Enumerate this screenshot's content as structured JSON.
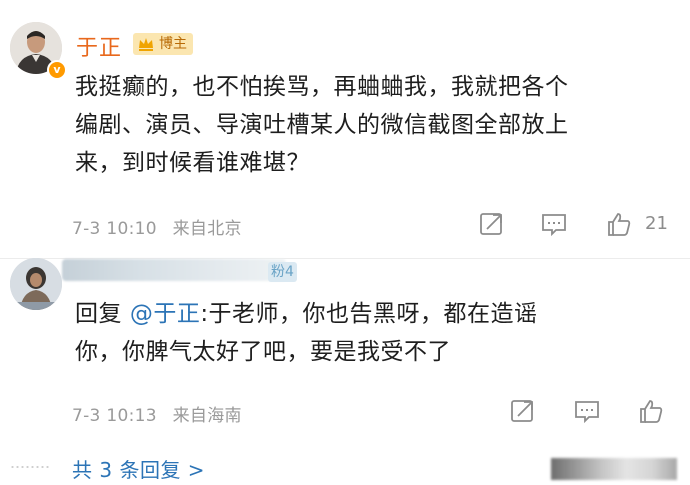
{
  "comments": [
    {
      "username": "于正",
      "badge": "博主",
      "verified_mark": "v",
      "text_lines": [
        "我挺癫的，也不怕挨骂，再蛐蛐我，我就把各个",
        "编剧、演员、导演吐槽某人的微信截图全部放上",
        "来，到时候看谁难堪？"
      ],
      "time": "7-3 10:10",
      "location": "来自北京",
      "likes": "21",
      "icons": [
        "share-icon",
        "comment-icon",
        "like-icon"
      ]
    },
    {
      "username_blurred": true,
      "fan_badge": "粉4",
      "reply_prefix": "回复",
      "mention": "@于正",
      "text_first_line": ":于老师，你也告黑呀，都在造谣",
      "text_second_line": "你，你脾气太好了吧，要是我受不了",
      "time": "7-3 10:13",
      "location": "来自海南",
      "icons": [
        "share-icon",
        "comment-icon",
        "like-icon"
      ]
    }
  ],
  "footer": {
    "more_replies": "共 3 条回复 >"
  },
  "colors": {
    "username": "#e8681c",
    "link": "#2c74b6",
    "meta": "#9a9a9a",
    "badge_bg": "#fbe6b0"
  }
}
